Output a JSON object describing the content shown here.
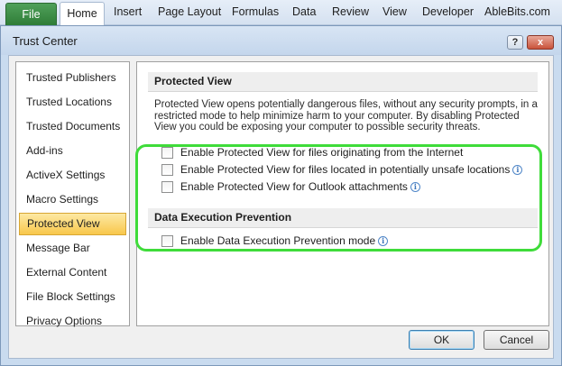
{
  "ribbon": {
    "file": "File",
    "tabs": [
      "Home",
      "Insert",
      "Page Layout",
      "Formulas",
      "Data",
      "Review",
      "View",
      "Developer",
      "AbleBits.com"
    ]
  },
  "dialog": {
    "title": "Trust Center",
    "help_glyph": "?",
    "close_glyph": "x"
  },
  "nav": {
    "items": [
      "Trusted Publishers",
      "Trusted Locations",
      "Trusted Documents",
      "Add-ins",
      "ActiveX Settings",
      "Macro Settings",
      "Protected View",
      "Message Bar",
      "External Content",
      "File Block Settings",
      "Privacy Options"
    ],
    "selected_index": 6
  },
  "protected_view": {
    "heading": "Protected View",
    "description": "Protected View opens potentially dangerous files, without any security prompts, in a restricted mode to help minimize harm to your computer. By disabling Protected View you could be exposing your computer to possible security threats.",
    "options": [
      {
        "label": "Enable Protected View for files originating from the Internet",
        "checked": false,
        "info": false
      },
      {
        "label": "Enable Protected View for files located in potentially unsafe locations",
        "checked": false,
        "info": true
      },
      {
        "label": "Enable Protected View for Outlook attachments",
        "checked": false,
        "info": true
      }
    ]
  },
  "dep": {
    "heading": "Data Execution Prevention",
    "option": {
      "label": "Enable Data Execution Prevention mode",
      "checked": false,
      "info": true
    }
  },
  "info_glyph": "i",
  "buttons": {
    "ok": "OK",
    "cancel": "Cancel"
  },
  "colors": {
    "highlight": "#3fdc3a",
    "file_tab": "#2f7d37",
    "selected_nav": "#f8c74b"
  }
}
